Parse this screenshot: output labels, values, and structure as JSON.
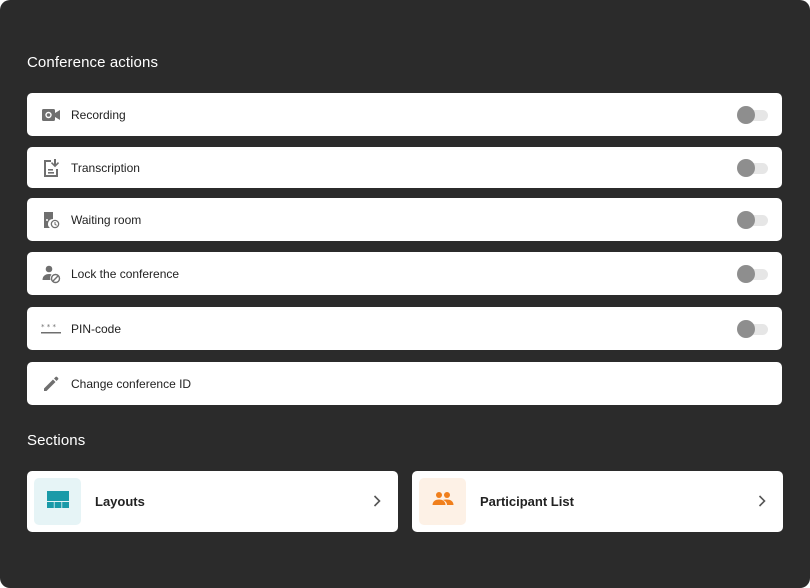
{
  "conference_actions": {
    "title": "Conference actions",
    "items": [
      {
        "label": "Recording",
        "icon": "video-camera-icon",
        "toggle": false
      },
      {
        "label": "Transcription",
        "icon": "transcription-icon",
        "toggle": false
      },
      {
        "label": "Waiting room",
        "icon": "waiting-room-icon",
        "toggle": false
      },
      {
        "label": "Lock the conference",
        "icon": "lock-user-icon",
        "toggle": false
      },
      {
        "label": "PIN-code",
        "icon": "pin-code-icon",
        "toggle": false
      },
      {
        "label": "Change conference ID",
        "icon": "pencil-icon"
      }
    ]
  },
  "sections": {
    "title": "Sections",
    "cards": [
      {
        "label": "Layouts",
        "icon": "layout-icon",
        "accent": "#1a9aa8",
        "tile_bg": "#e6f4f6"
      },
      {
        "label": "Participant List",
        "icon": "participants-icon",
        "accent": "#f07f1c",
        "tile_bg": "#fdf1e6"
      }
    ]
  },
  "colors": {
    "background": "#2b2b2b",
    "row_bg": "#ffffff",
    "icon_gray": "#6f6f6f",
    "toggle_thumb": "#8e8e8e",
    "toggle_track": "#e6e6e6"
  }
}
